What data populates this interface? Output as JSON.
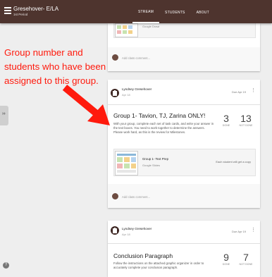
{
  "appbar": {
    "title": "Gresehover- E/LA",
    "subtitle": "1st Period",
    "tabs": [
      {
        "label": "STREAM",
        "active": true
      },
      {
        "label": "STUDENTS",
        "active": false
      },
      {
        "label": "ABOUT",
        "active": false
      }
    ],
    "color": "#4e342e"
  },
  "side_tab_icon": "chevrons-right-icon",
  "help_label": "?",
  "previous_post": {
    "attachment_type": "Google Drawi",
    "comment_placeholder": "Add class comment..."
  },
  "post1": {
    "author": "Lyndsey Gresehover",
    "date": "Apr 18",
    "due": "Due Apr 19",
    "title": "Group 1- Tavion, TJ, Zarina ONLY!",
    "description": "With your group, complete each set of task cards, and write your answer in the text boxes. You need to work together to determine the answers. Please work hard, as this is the review for Milestones.",
    "stats": [
      {
        "value": "3",
        "label": "DONE"
      },
      {
        "value": "13",
        "label": "NOT DONE"
      }
    ],
    "attachment": {
      "title": "Group 1- Text Prep",
      "type": "Google Slides",
      "mode": "Each student will get a copy"
    },
    "comment_placeholder": "Add class comment..."
  },
  "post2": {
    "author": "Lyndsey Gresehover",
    "date": "Apr 18",
    "due": "Due Apr 19",
    "title": "Conclusion Paragraph",
    "description": "Follow the instructions on the attached graphic organizer in order to accurately complete your conclusion paragraph.",
    "stats": [
      {
        "value": "9",
        "label": "DONE"
      },
      {
        "value": "7",
        "label": "NOT DONE"
      }
    ]
  },
  "annotation": {
    "text": "Group number and students who have been assigned to this group.",
    "color": "#ff1a0d"
  }
}
